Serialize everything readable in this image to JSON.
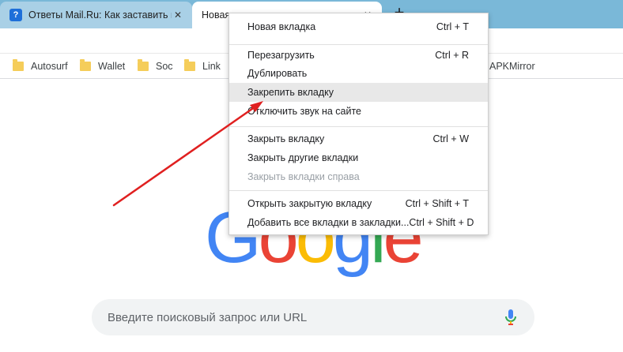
{
  "tabs": [
    {
      "title": "Ответы Mail.Ru: Как заставить в",
      "icon": "question-icon",
      "close": "✕"
    },
    {
      "title": "Новая вкладка",
      "close": "✕"
    }
  ],
  "new_tab_glyph": "+",
  "bookmarks": [
    "Autosurf",
    "Wallet",
    "Soc",
    "Link",
    "APKMirror"
  ],
  "logo": {
    "letters": [
      "G",
      "o",
      "o",
      "g",
      "l",
      "e"
    ],
    "colors": [
      "#4285F4",
      "#EA4335",
      "#FBBC05",
      "#4285F4",
      "#34A853",
      "#EA4335"
    ]
  },
  "search": {
    "placeholder": "Введите поисковый запрос или URL"
  },
  "context_menu": {
    "items": [
      {
        "label": "Новая вкладка",
        "shortcut": "Ctrl + T"
      },
      {
        "label": "Перезагрузить",
        "shortcut": "Ctrl + R"
      },
      {
        "label": "Дублировать",
        "shortcut": ""
      },
      {
        "label": "Закрепить вкладку",
        "shortcut": "",
        "highlighted": true
      },
      {
        "label": "Отключить звук на сайте",
        "shortcut": ""
      },
      {
        "label": "Закрыть вкладку",
        "shortcut": "Ctrl + W"
      },
      {
        "label": "Закрыть другие вкладки",
        "shortcut": ""
      },
      {
        "label": "Закрыть вкладки справа",
        "shortcut": "",
        "disabled": true
      },
      {
        "label": "Открыть закрытую вкладку",
        "shortcut": "Ctrl + Shift + T"
      },
      {
        "label": "Добавить все вкладки в закладки...",
        "shortcut": "Ctrl + Shift + D"
      }
    ]
  },
  "colors": {
    "tab_strip": "#7ab8d8",
    "menu_highlight": "#e8e8e8",
    "arrow": "#e02020"
  }
}
